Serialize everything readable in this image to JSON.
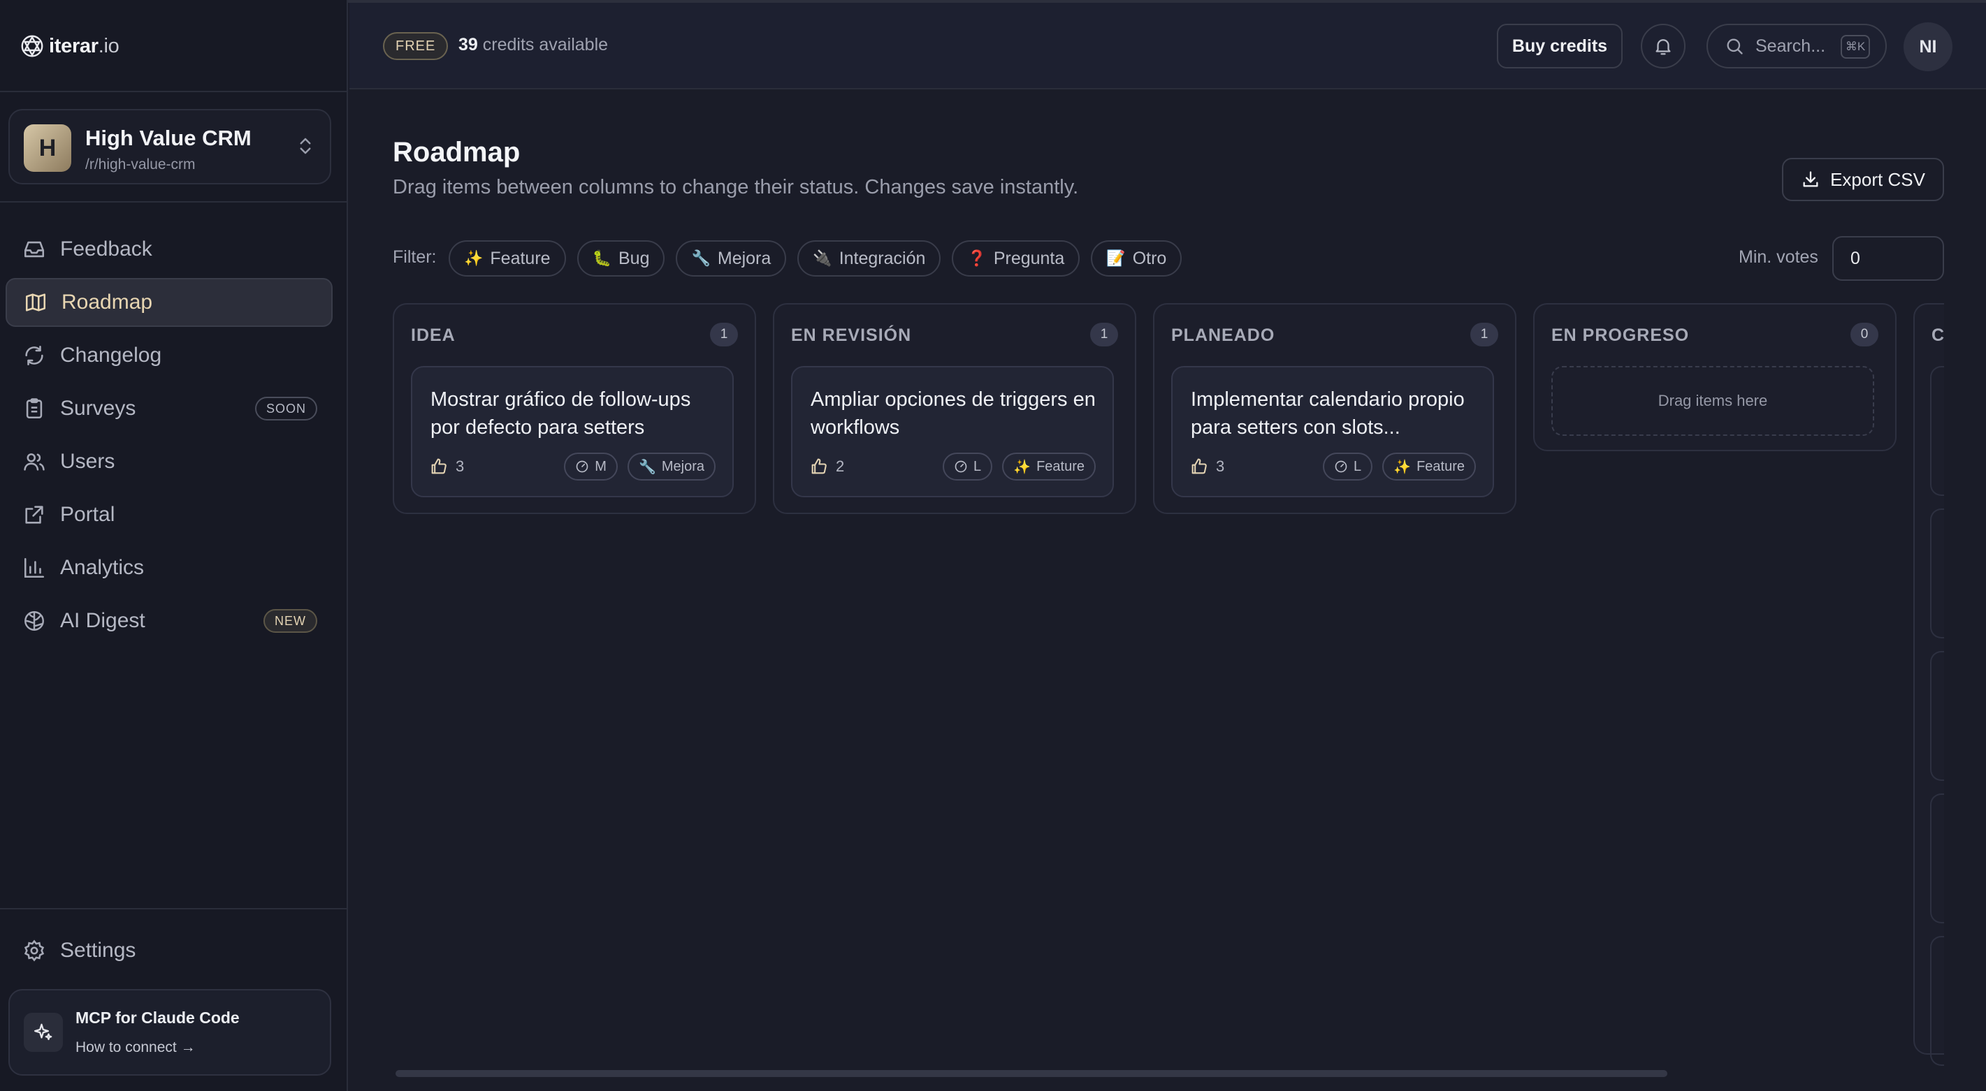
{
  "brand": {
    "name_bold": "iterar",
    "name_rest": ".io"
  },
  "project": {
    "initial": "H",
    "name": "High Value CRM",
    "slug": "/r/high-value-crm"
  },
  "nav": [
    {
      "label": "Feedback",
      "icon": "inbox-icon"
    },
    {
      "label": "Roadmap",
      "icon": "map-icon",
      "active": true
    },
    {
      "label": "Changelog",
      "icon": "refresh-icon"
    },
    {
      "label": "Surveys",
      "icon": "clipboard-icon",
      "badge": "SOON"
    },
    {
      "label": "Users",
      "icon": "users-icon"
    },
    {
      "label": "Portal",
      "icon": "external-link-icon"
    },
    {
      "label": "Analytics",
      "icon": "bar-chart-icon"
    },
    {
      "label": "AI Digest",
      "icon": "brain-icon",
      "badge": "NEW"
    }
  ],
  "settings": {
    "label": "Settings"
  },
  "mcp": {
    "title": "MCP for Claude Code",
    "link": "How to connect →"
  },
  "topbar": {
    "plan": "FREE",
    "credits_count": "39",
    "credits_text": "credits available",
    "buy_label": "Buy credits",
    "search_placeholder": "Search...",
    "search_shortcut": "⌘K",
    "avatar_initials": "NI"
  },
  "page": {
    "title": "Roadmap",
    "subtitle": "Drag items between columns to change their status. Changes save instantly.",
    "export_label": "Export CSV"
  },
  "filters": {
    "label": "Filter:",
    "chips": [
      {
        "emoji": "✨",
        "label": "Feature"
      },
      {
        "emoji": "🐛",
        "label": "Bug"
      },
      {
        "emoji": "🔧",
        "label": "Mejora"
      },
      {
        "emoji": "🔌",
        "label": "Integración"
      },
      {
        "emoji": "❓",
        "label": "Pregunta"
      },
      {
        "emoji": "📝",
        "label": "Otro"
      }
    ],
    "min_votes_label": "Min. votes",
    "min_votes_value": "0"
  },
  "columns": [
    {
      "title": "IDEA",
      "count": "1",
      "card": {
        "title": "Mostrar gráfico de follow-ups por defecto para setters",
        "votes": "3",
        "size": "M",
        "tag_emoji": "🔧",
        "tag": "Mejora"
      }
    },
    {
      "title": "EN REVISIÓN",
      "count": "1",
      "card": {
        "title": "Ampliar opciones de triggers en workflows",
        "votes": "2",
        "size": "L",
        "tag_emoji": "✨",
        "tag": "Feature"
      }
    },
    {
      "title": "PLANEADO",
      "count": "1",
      "card": {
        "title": "Implementar calendario propio para setters con slots...",
        "votes": "3",
        "size": "L",
        "tag_emoji": "✨",
        "tag": "Feature"
      }
    },
    {
      "title": "EN PROGRESO",
      "count": "0",
      "empty_text": "Drag items here"
    },
    {
      "title": "C"
    }
  ],
  "colors": {
    "accent": "#e8d6b2",
    "background": "#1a1c28",
    "sidebar": "#171924"
  }
}
